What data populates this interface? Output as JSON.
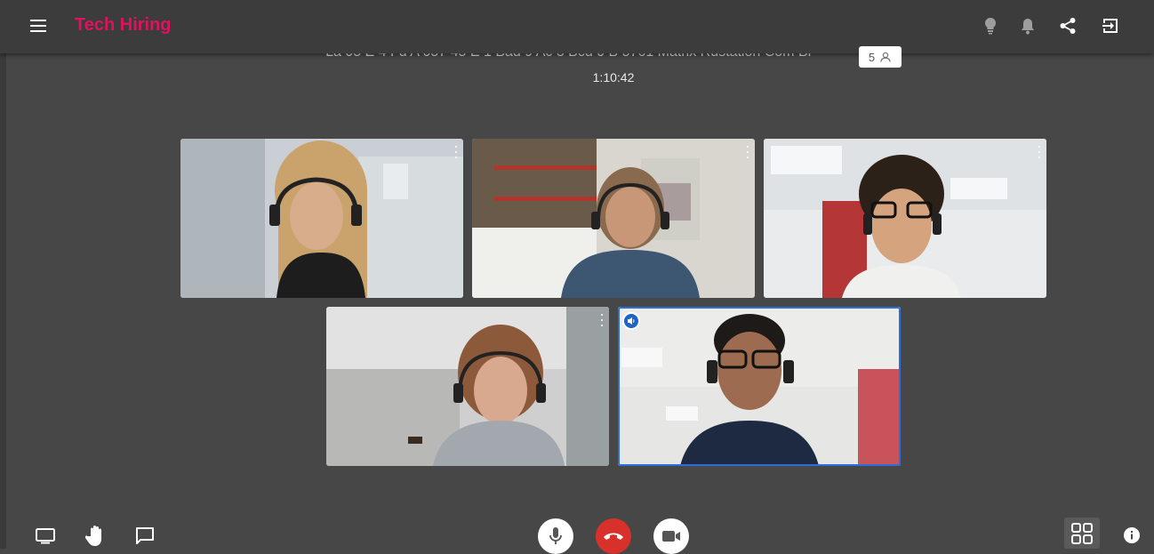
{
  "app": {
    "title": "Tech Hiring",
    "accent_color": "#e0115f"
  },
  "header": {
    "icons": [
      "menu-icon",
      "lightbulb-icon",
      "bell-icon",
      "share-icon",
      "exit-icon"
    ]
  },
  "meeting": {
    "name": "La 05 E 4 Fd A 057 45 E 1 Bad 9 Ac 8 Bcd 0 B 5761 Matrix Rustation Com Br",
    "participant_count": "5",
    "elapsed_time": "1:10:42"
  },
  "participants": [
    {
      "icon": "more-vert-icon"
    },
    {
      "icon": "more-vert-icon"
    },
    {
      "icon": "more-vert-icon"
    },
    {
      "icon": "more-vert-icon"
    },
    {
      "icon": "speaking-icon",
      "speaking": true
    }
  ],
  "toolbar": {
    "left": [
      "screen-share-icon",
      "raise-hand-icon",
      "chat-icon"
    ],
    "center": [
      "microphone-icon",
      "hang-up-icon",
      "camera-icon"
    ],
    "right": [
      "grid-layout-icon",
      "info-icon"
    ],
    "hangup_color": "#d8312c"
  }
}
